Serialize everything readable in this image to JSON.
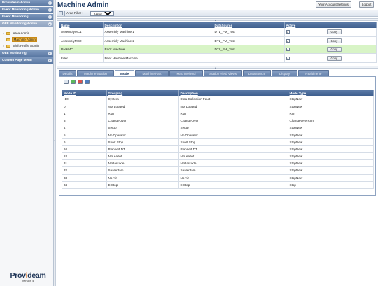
{
  "sidebar": {
    "sections": [
      {
        "label": "Proviideam Admin",
        "active": false
      },
      {
        "label": "Event Monitoring Admin",
        "active": false
      },
      {
        "label": "Event Monitoring",
        "active": false
      },
      {
        "label": "OEE Monitoring Admin",
        "active": true
      }
    ],
    "tree_items": [
      {
        "label": "Area Admin",
        "selected": false
      },
      {
        "label": "Machine Admin",
        "selected": true
      },
      {
        "label": "Shift Profile Admin",
        "selected": false
      }
    ],
    "bottom_sections": [
      {
        "label": "OEE Monitoring"
      },
      {
        "label": "Custom Page Menu"
      }
    ],
    "logo": {
      "brand_a": "Prov",
      "brand_dot": "i",
      "brand_b": "deam",
      "version": "Version 4"
    }
  },
  "header": {
    "title": "Machine Admin",
    "settings_label": "Your Account Settings",
    "logout_label": "Logout"
  },
  "toolbar": {
    "filter_label": "Area Filter :",
    "filter_value": "Assembly"
  },
  "machines": {
    "columns": [
      "Name",
      "Description",
      "DataSource",
      "Active",
      ""
    ],
    "rows": [
      {
        "name": "AssemblyMC1",
        "description": "Assembly Machine 1",
        "datasource": "DTL_PM_Test",
        "active": true,
        "action": "Copy",
        "highlight": false
      },
      {
        "name": "AssemblyMC2",
        "description": "Assembly Machine 2",
        "datasource": "DTL_PM_Test",
        "active": true,
        "action": "Copy",
        "highlight": false
      },
      {
        "name": "PackMC",
        "description": "Pack Machine",
        "datasource": "DTL_PM_Test",
        "active": true,
        "action": "Copy",
        "highlight": true
      },
      {
        "name": "Filler",
        "description": "Filler Machine Machine",
        "datasource": "",
        "active": true,
        "action": "Copy",
        "highlight": false
      }
    ]
  },
  "tabs": [
    {
      "label": "Details",
      "active": false
    },
    {
      "label": "Machine Station",
      "active": false
    },
    {
      "label": "Mode",
      "active": true
    },
    {
      "label": "Machine/Part",
      "active": false
    },
    {
      "label": "Machine/Tool",
      "active": false
    },
    {
      "label": "Station Yield Views",
      "active": false
    },
    {
      "label": "DataSource",
      "active": false
    },
    {
      "label": "Display",
      "active": false
    },
    {
      "label": "Realtime IF",
      "active": false
    }
  ],
  "modes": {
    "columns": [
      "Mode ID",
      "Grouping",
      "Description",
      "Mode Type"
    ],
    "rows": [
      [
        "-10",
        "System",
        "Data Collection Fault",
        "StopNew"
      ],
      [
        "0",
        "Not Logged",
        "Not Logged",
        "StopNew"
      ],
      [
        "1",
        "Run",
        "Run",
        "Run"
      ],
      [
        "3",
        "ChangeOver",
        "ChangeOver",
        "ChangeOverRun"
      ],
      [
        "4",
        "Setup",
        "Setup",
        "StopNew"
      ],
      [
        "5",
        "No Operator",
        "No Operator",
        "StopNew"
      ],
      [
        "6",
        "Short Stop",
        "Short Stop",
        "StopNew"
      ],
      [
        "10",
        "Planned DT",
        "Planned DT",
        "StopNew"
      ],
      [
        "24",
        "NoLeaflet",
        "NoLeaflet",
        "StopNew"
      ],
      [
        "31",
        "NoBarcode",
        "NoBarcode",
        "StopNew"
      ],
      [
        "32",
        "SealerJam",
        "SealerJam",
        "StopNew"
      ],
      [
        "33",
        "No Air",
        "No Air",
        "StopNew"
      ],
      [
        "34",
        "E Stop",
        "E Stop",
        "Stop"
      ]
    ]
  }
}
